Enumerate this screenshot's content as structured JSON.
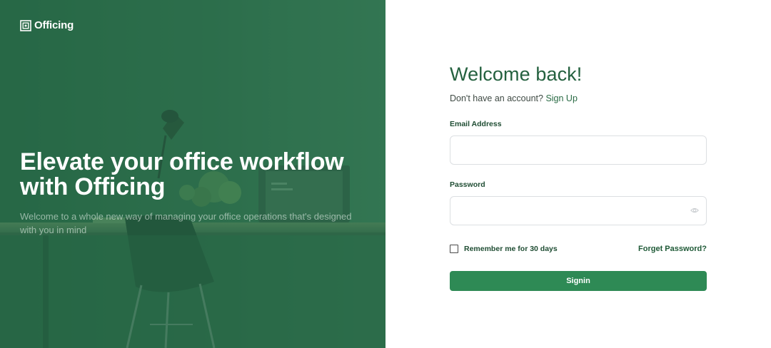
{
  "brand": {
    "name": "Officing"
  },
  "hero": {
    "title": "Elevate your office workflow with Officing",
    "subtitle": "Welcome to a whole new way of managing your office operations that's designed with you in mind"
  },
  "form": {
    "title": "Welcome back!",
    "signup_prompt": "Don't have an account?",
    "signup_link": "Sign Up",
    "email_label": "Email Address",
    "email_value": "",
    "password_label": "Password",
    "password_value": "",
    "remember_label": "Remember me for 30 days",
    "forgot_label": "Forget Password?",
    "submit_label": "Signin"
  },
  "icons": {
    "brand": "officing-logo-icon",
    "password_toggle": "eye-icon"
  },
  "colors": {
    "hero_overlay": "#2e704c",
    "title_green": "#24613f",
    "button_green": "#2e8a55",
    "label_green": "#1f4d33"
  }
}
